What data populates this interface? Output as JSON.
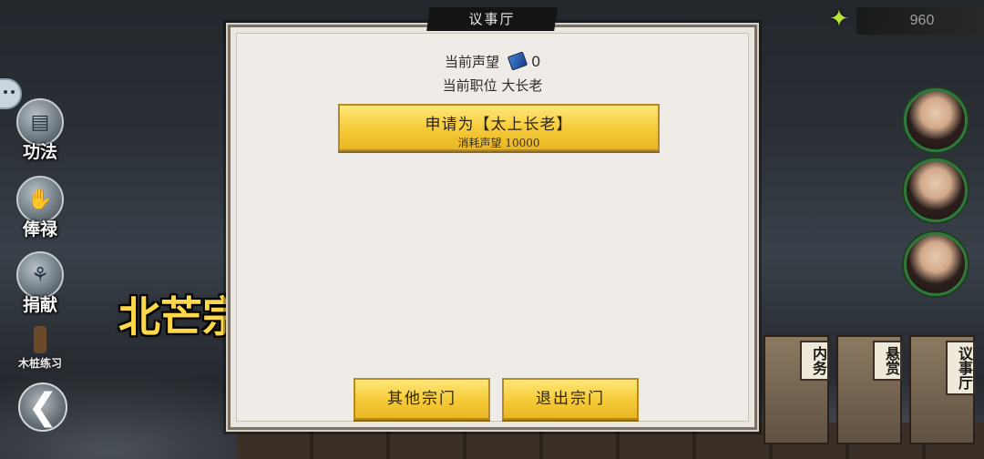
{
  "dialog": {
    "title": "议事厅",
    "reputation_label": "当前声望",
    "reputation_value": "0",
    "rank_label": "当前职位",
    "rank_value": "大长老",
    "apply_button": {
      "label": "申请为【太上长老】",
      "cost": "消耗声望 10000"
    },
    "other_sects_button": "其他宗门",
    "leave_sect_button": "退出宗门"
  },
  "sidebar": {
    "items": [
      {
        "label": "功法",
        "icon": "book-icon"
      },
      {
        "label": "俸禄",
        "icon": "handshake-icon"
      },
      {
        "label": "捐献",
        "icon": "donate-icon"
      },
      {
        "label": "木桩练习",
        "icon": "training-dummy-icon"
      }
    ]
  },
  "sect_name": "北芒宗",
  "currency": {
    "value": "960",
    "icon": "spirit-stone-icon"
  },
  "task_cards": [
    {
      "label": "内务"
    },
    {
      "label": "悬赏"
    },
    {
      "label": "议事厅"
    }
  ],
  "colors": {
    "button_gold": "#f6cc3a",
    "panel_bg": "#efece7",
    "sect_name": "#ffd84a",
    "portrait_ring": "#2f7a3a"
  }
}
